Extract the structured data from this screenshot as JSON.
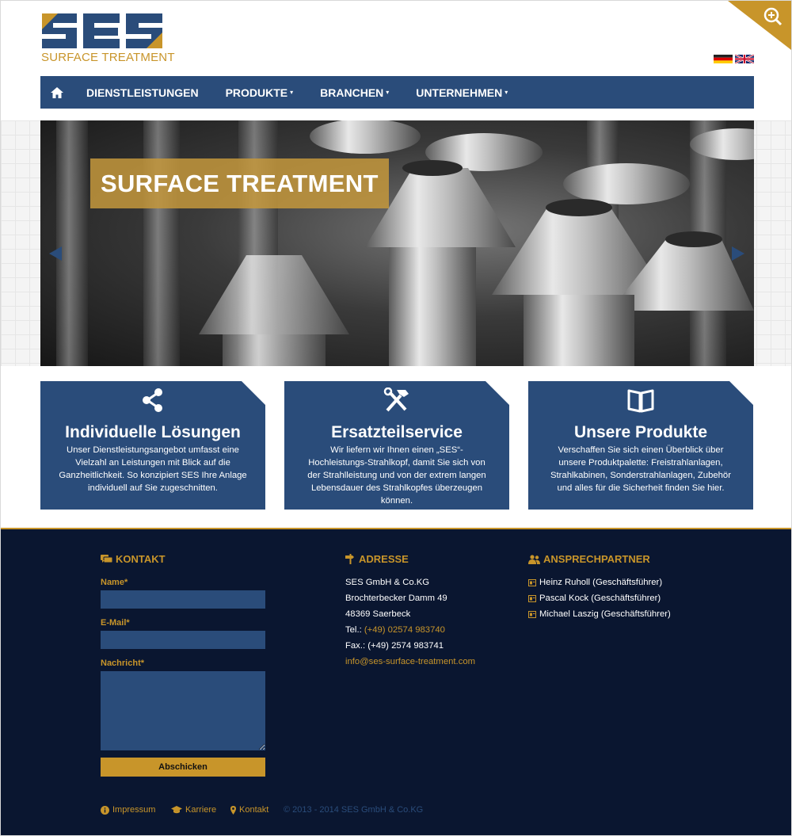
{
  "header": {
    "logo_main": "SES",
    "logo_sub": "SURFACE TREATMENT",
    "zoom_icon": "zoom-in-icon",
    "languages": [
      "de",
      "en"
    ]
  },
  "nav": {
    "home_icon": "home-icon",
    "items": [
      {
        "label": "DIENSTLEISTUNGEN",
        "dropdown": false
      },
      {
        "label": "PRODUKTE",
        "dropdown": true
      },
      {
        "label": "BRANCHEN",
        "dropdown": true
      },
      {
        "label": "UNTERNEHMEN",
        "dropdown": true
      }
    ],
    "caret": "▾"
  },
  "hero": {
    "title": "SURFACE TREATMENT"
  },
  "boxes": [
    {
      "icon": "share-icon",
      "title": "Individuelle Lösungen",
      "text": "Unser Dienstleistungsangebot umfasst eine Vielzahl an Leistungen mit Blick auf die Ganzheitlichkeit. So konzipiert SES Ihre Anlage individuell auf Sie zugeschnitten."
    },
    {
      "icon": "tools-icon",
      "title": "Ersatzteilservice",
      "text": "Wir liefern wir Ihnen einen „SES“- Hochleistungs-Strahlkopf, damit Sie sich von der Strahlleistung und von der extrem langen Lebensdauer des Strahlkopfes überzeugen können."
    },
    {
      "icon": "book-icon",
      "title": "Unsere Produkte",
      "text": "Verschaffen Sie sich einen Überblick über unsere Produktpalette: Freistrahlanlagen, Strahlkabinen, Sonderstrahlanlagen, Zubehör und alles für die Sicherheit finden Sie hier."
    }
  ],
  "footer": {
    "kontakt": {
      "heading": "KONTAKT",
      "name_label": "Name*",
      "email_label": "E-Mail*",
      "message_label": "Nachricht*",
      "submit_label": "Abschicken"
    },
    "adresse": {
      "heading": "ADRESSE",
      "company": "SES GmbH & Co.KG",
      "street": "Brochterbecker Damm 49",
      "city": "48369 Saerbeck",
      "tel_label": "Tel.:",
      "tel": "(+49) 02574 983740",
      "fax": "Fax.: (+49) 2574 983741",
      "email": "info@ses-surface-treatment.com"
    },
    "ansprechpartner": {
      "heading": "ANSPRECHPARTNER",
      "people": [
        "Heinz Ruholl (Geschäftsführer)",
        "Pascal Kock (Geschäftsführer)",
        "Michael Laszig (Geschäftsführer)"
      ]
    },
    "links": {
      "impressum": "Impressum",
      "karriere": "Karriere",
      "kontakt": "Kontakt"
    },
    "copyright": "© 2013 - 2014 SES GmbH & Co.KG"
  },
  "colors": {
    "brand_blue": "#2a4c7a",
    "brand_gold": "#c8952a",
    "footer_bg": "#0a1630"
  }
}
